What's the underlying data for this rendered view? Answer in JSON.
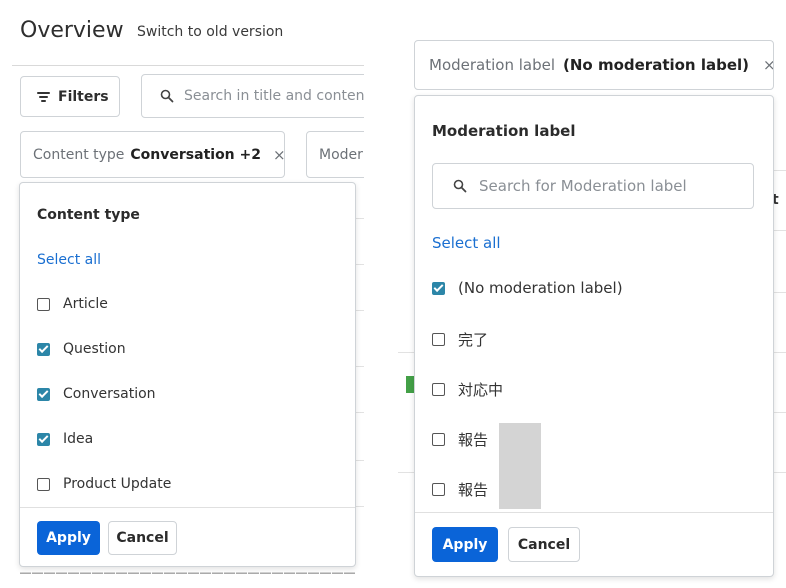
{
  "left": {
    "page_title": "Overview",
    "switch_link": "Switch to old version",
    "filters_button": "Filters",
    "search_placeholder": "Search in title and content",
    "chip_content": {
      "key": "Content type",
      "value": "Conversation +2",
      "close": "×"
    },
    "chip_moder": {
      "key": "Moder"
    },
    "panel": {
      "title": "Content type",
      "select_all": "Select all",
      "options": [
        {
          "label": "Article",
          "checked": false
        },
        {
          "label": "Question",
          "checked": true
        },
        {
          "label": "Conversation",
          "checked": true
        },
        {
          "label": "Idea",
          "checked": true
        },
        {
          "label": "Product Update",
          "checked": false
        }
      ],
      "apply": "Apply",
      "cancel": "Cancel"
    },
    "bottom_strip_text": "――――――――――――――――――――――――――――"
  },
  "right": {
    "chip": {
      "key": "Moderation label",
      "value": "(No moderation label)",
      "close": "×"
    },
    "panel": {
      "title": "Moderation label",
      "search_placeholder": "Search for Moderation label",
      "select_all": "Select all",
      "options": [
        {
          "label": "(No moderation label)",
          "checked": true
        },
        {
          "label": "完了",
          "checked": false
        },
        {
          "label": "対応中",
          "checked": false
        },
        {
          "label": "報告",
          "checked": false
        },
        {
          "label": "報告",
          "checked": false
        }
      ],
      "apply": "Apply",
      "cancel": "Cancel"
    },
    "edge_letter": "t"
  },
  "colors": {
    "accent_blue": "#0a64d8",
    "link_blue": "#1a6fd1",
    "checkbox_checked": "#2c86a8",
    "border": "#cfd3d7"
  }
}
